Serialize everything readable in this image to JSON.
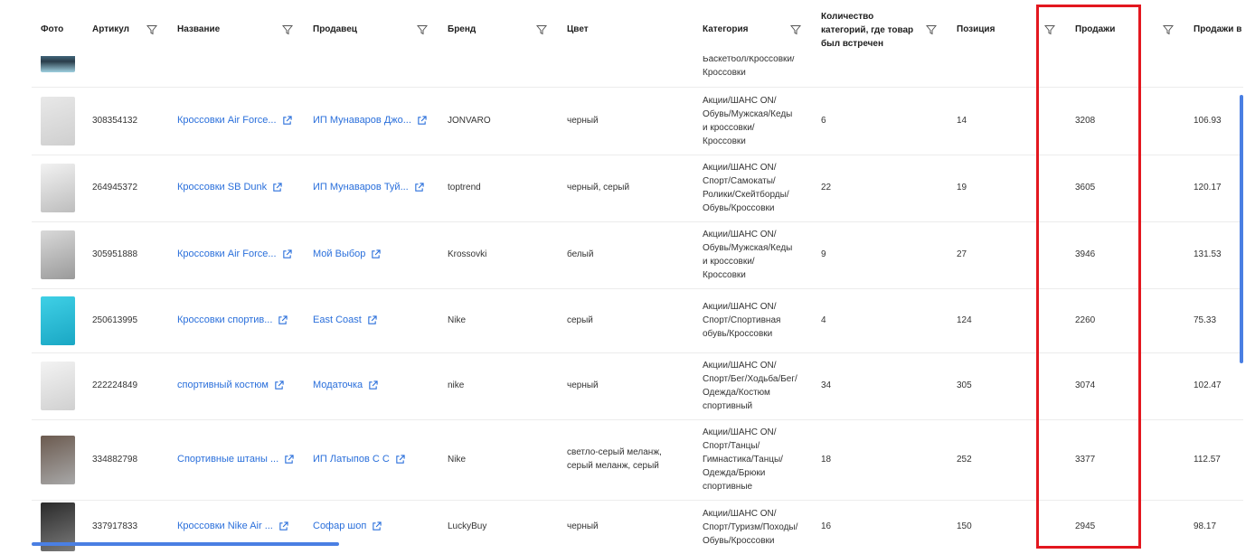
{
  "headers": {
    "photo": "Фото",
    "sku": "Артикул",
    "name": "Название",
    "seller": "Продавец",
    "brand": "Бренд",
    "color": "Цвет",
    "category": "Категория",
    "cat_count": "Количество категорий, где товар был встречен",
    "position": "Позиция",
    "sales": "Продажи",
    "sales_per": "Продажи в"
  },
  "partial_row": {
    "category": "Баскетбол/Кроссовки/\nКроссовки"
  },
  "rows": [
    {
      "sku": "308354132",
      "name": "Кроссовки Air Force...",
      "seller": "ИП Мунаваров Джо...",
      "brand": "JONVARO",
      "color": "черный",
      "category": "Акции/ШАНС ON/\nОбувь/Мужская/Кеды\nи кроссовки/\nКроссовки",
      "cat_count": "6",
      "position": "14",
      "sales": "3208",
      "sales_per": "106.93"
    },
    {
      "sku": "264945372",
      "name": "Кроссовки SB Dunk",
      "seller": "ИП Мунаваров Туй...",
      "brand": "toptrend",
      "color": "черный, серый",
      "category": "Акции/ШАНС ON/\nСпорт/Самокаты/\nРолики/Скейтборды/\nОбувь/Кроссовки",
      "cat_count": "22",
      "position": "19",
      "sales": "3605",
      "sales_per": "120.17"
    },
    {
      "sku": "305951888",
      "name": "Кроссовки Air Force...",
      "seller": "Мой Выбор",
      "brand": "Krossovki",
      "color": "белый",
      "category": "Акции/ШАНС ON/\nОбувь/Мужская/Кеды\nи кроссовки/\nКроссовки",
      "cat_count": "9",
      "position": "27",
      "sales": "3946",
      "sales_per": "131.53"
    },
    {
      "sku": "250613995",
      "name": "Кроссовки спортив...",
      "seller": "East Coast",
      "brand": "Nike",
      "color": "серый",
      "category": "Акции/ШАНС ON/\nСпорт/Спортивная\nобувь/Кроссовки",
      "cat_count": "4",
      "position": "124",
      "sales": "2260",
      "sales_per": "75.33"
    },
    {
      "sku": "222224849",
      "name": "спортивный костюм",
      "seller": "Модаточка",
      "brand": "nike",
      "color": "черный",
      "category": "Акции/ШАНС ON/\nСпорт/Бег/Ходьба/Бег/\nОдежда/Костюм\nспортивный",
      "cat_count": "34",
      "position": "305",
      "sales": "3074",
      "sales_per": "102.47"
    },
    {
      "sku": "334882798",
      "name": "Спортивные штаны ...",
      "seller": "ИП Латыпов С С",
      "brand": "Nike",
      "color": "светло-серый меланж,\nсерый меланж, серый",
      "category": "Акции/ШАНС ON/\nСпорт/Танцы/\nГимнастика/Танцы/\nОдежда/Брюки\nспортивные",
      "cat_count": "18",
      "position": "252",
      "sales": "3377",
      "sales_per": "112.57"
    },
    {
      "sku": "337917833",
      "name": "Кроссовки Nike Air ...",
      "seller": "Софар шоп",
      "brand": "LuckyBuy",
      "color": "черный",
      "category": "Акции/ШАНС ON/\nСпорт/Туризм/Походы/\nОбувь/Кроссовки",
      "cat_count": "16",
      "position": "150",
      "sales": "2945",
      "sales_per": "98.17"
    }
  ],
  "colors": {
    "link": "#2a6fdb",
    "highlight": "#e3171f",
    "scrollbar": "#4a7fe3"
  }
}
